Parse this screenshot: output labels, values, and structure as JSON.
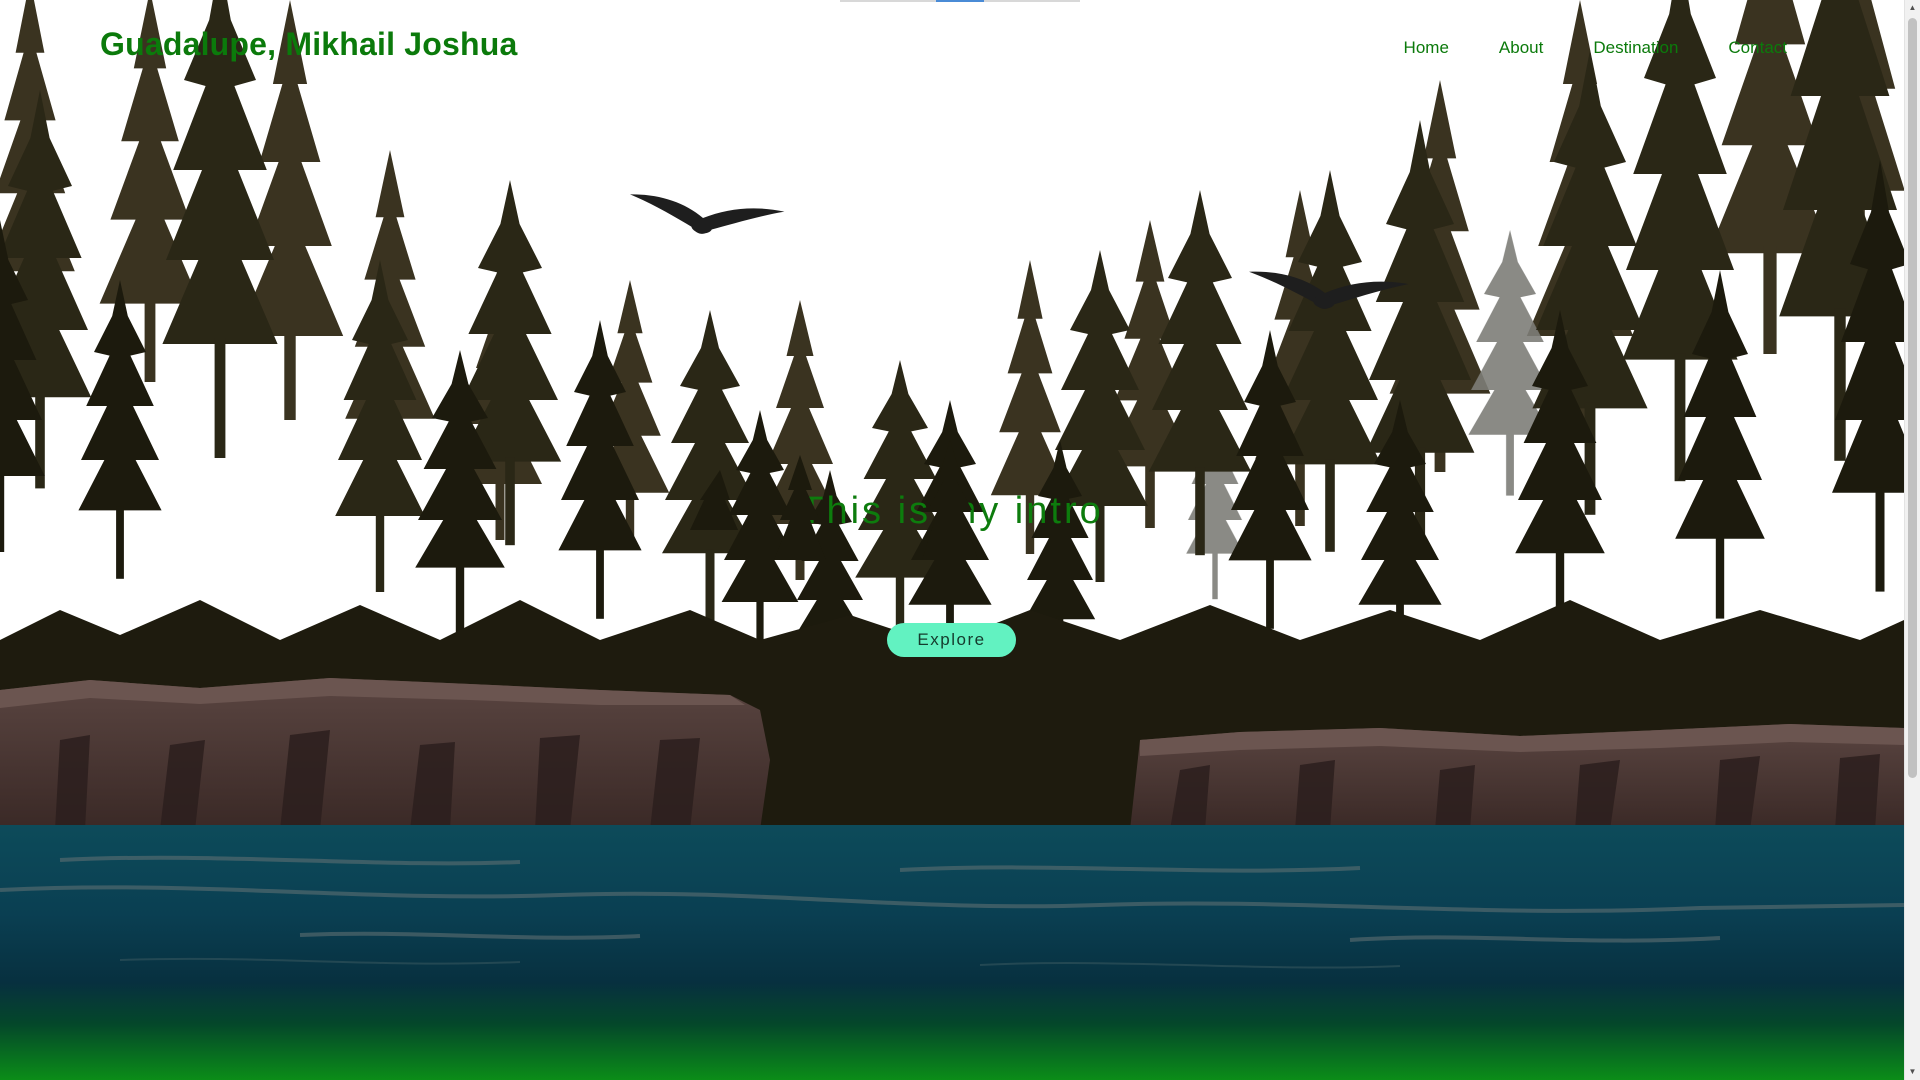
{
  "header": {
    "site_title": "Guadalupe, Mikhail Joshua",
    "nav": [
      "Home",
      "About",
      "Destination",
      "Contact"
    ]
  },
  "hero": {
    "text": "This is my intro",
    "button_label": "Explore"
  },
  "colors": {
    "title_green": "#0b7a0b",
    "button_mint": "#62f2c1",
    "forest_dark": "#1b1a0e",
    "cliff_brown": "#4a3834",
    "water_teal": "#0a4a5c",
    "bottom_green": "#0b8a1a"
  }
}
